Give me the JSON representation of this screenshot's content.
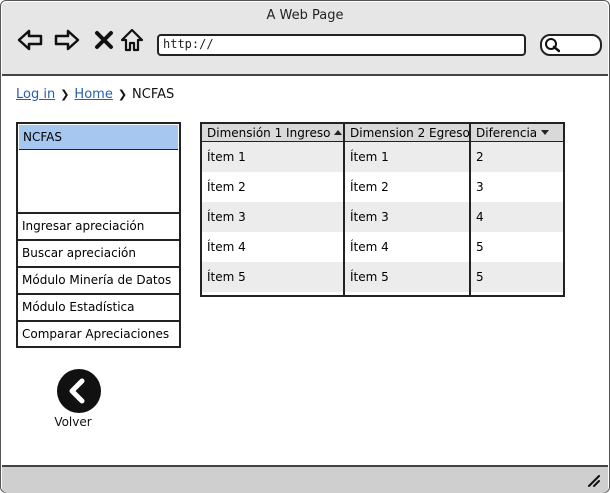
{
  "window": {
    "title": "A Web Page"
  },
  "browser": {
    "url": "http://"
  },
  "breadcrumb": {
    "login": "Log in",
    "home": "Home",
    "current": "NCFAS"
  },
  "sidebar": {
    "header": "NCFAS",
    "items": [
      {
        "label": "Ingresar apreciación"
      },
      {
        "label": "Buscar apreciación"
      },
      {
        "label": "Módulo Minería de Datos"
      },
      {
        "label": "Módulo Estadística"
      },
      {
        "label": "Comparar Apreciaciones"
      }
    ]
  },
  "table": {
    "columns": [
      {
        "label": "Dimensión 1 Ingreso",
        "sort": "asc"
      },
      {
        "label": "Dimension 2 Egreso",
        "sort": "none"
      },
      {
        "label": "Diferencia",
        "sort": "desc"
      }
    ],
    "rows": [
      [
        "Ítem 1",
        "Ítem 1",
        "2"
      ],
      [
        "Ítem 2",
        "Ítem 2",
        "3"
      ],
      [
        "Ítem 3",
        "Ítem 3",
        "4"
      ],
      [
        "Ítem 4",
        "Ítem 4",
        "5"
      ],
      [
        "Ítem 5",
        "Ítem 5",
        "5"
      ]
    ]
  },
  "back": {
    "label": "Volver",
    "icon": "chevron-left-icon"
  },
  "colors": {
    "selected": "#a6c8f0",
    "link": "#2a5db0",
    "header_bg": "#d9d9d9",
    "alt_row": "#ececec"
  }
}
